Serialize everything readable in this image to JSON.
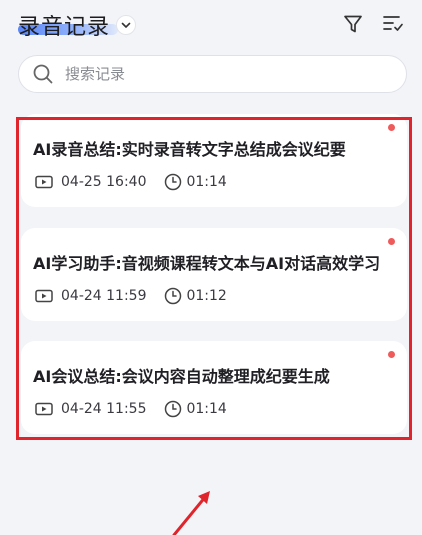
{
  "header": {
    "title": "录音记录",
    "icons": [
      "chevron-down-icon",
      "filter-icon",
      "multi-select-icon"
    ]
  },
  "search": {
    "placeholder": "搜索记录"
  },
  "records": [
    {
      "title": "AI录音总结:实时录音转文字总结成会议纪要",
      "date": "04-25 16:40",
      "duration": "01:14",
      "unread": true
    },
    {
      "title": "AI学习助手:音视频课程转文本与AI对话高效学习",
      "date": "04-24 11:59",
      "duration": "01:12",
      "unread": true
    },
    {
      "title": "AI会议总结:会议内容自动整理成纪要生成",
      "date": "04-24 11:55",
      "duration": "01:14",
      "unread": true
    }
  ],
  "colors": {
    "accent": "#5a86f5",
    "unread_dot": "#ef5a5a",
    "highlight_box": "#e0242c",
    "background": "#f3f4f8"
  }
}
